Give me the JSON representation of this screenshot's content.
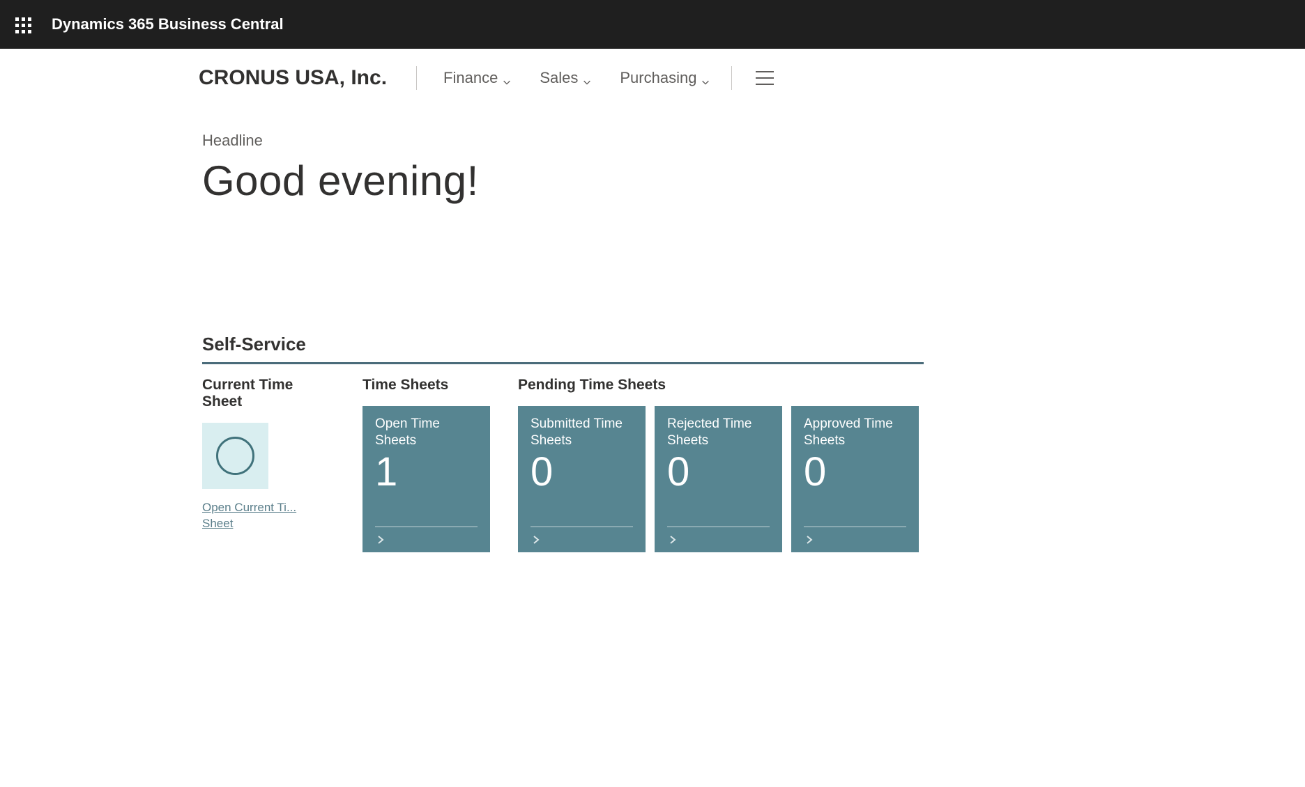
{
  "header": {
    "app_title": "Dynamics 365 Business Central"
  },
  "nav": {
    "company": "CRONUS USA, Inc.",
    "items": [
      "Finance",
      "Sales",
      "Purchasing"
    ]
  },
  "headline": {
    "label": "Headline",
    "greeting": "Good evening!"
  },
  "self_service": {
    "title": "Self-Service",
    "current_time_sheet": {
      "title": "Current Time Sheet",
      "link_line1": "Open Current Ti...",
      "link_line2": "Sheet"
    },
    "time_sheets": {
      "title": "Time Sheets",
      "tiles": [
        {
          "label": "Open Time Sheets",
          "value": "1"
        }
      ]
    },
    "pending_time_sheets": {
      "title": "Pending Time Sheets",
      "tiles": [
        {
          "label": "Submitted Time Sheets",
          "value": "0"
        },
        {
          "label": "Rejected Time Sheets",
          "value": "0"
        },
        {
          "label": "Approved Time Sheets",
          "value": "0"
        }
      ]
    }
  },
  "colors": {
    "tile_bg": "#578591",
    "accent": "#40727b"
  }
}
